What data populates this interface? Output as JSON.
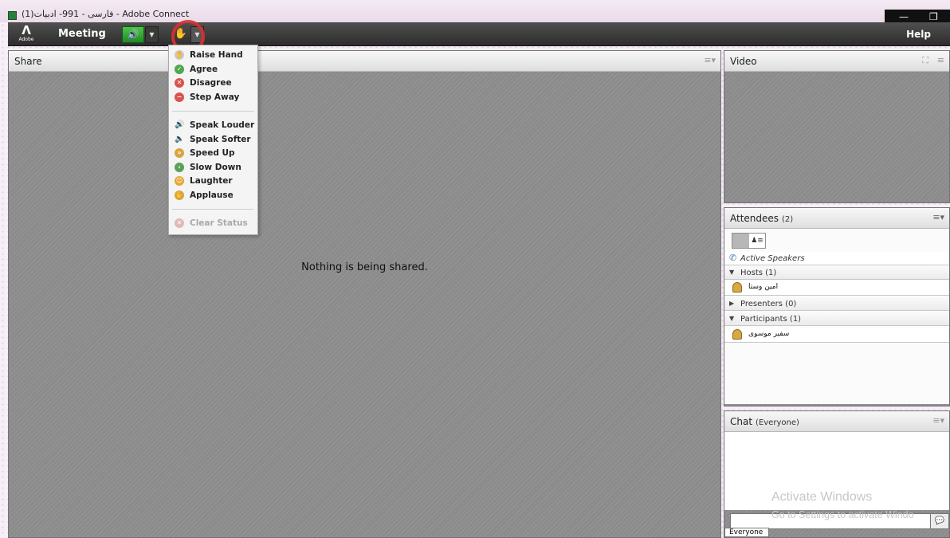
{
  "window": {
    "title": "(فارسی - 991- ادبیات(1 - Adobe Connect",
    "minimize_label": "—",
    "restore_label": "❐"
  },
  "toolbar": {
    "logo_word": "Adobe",
    "meeting_label": "Meeting",
    "help_label": "Help",
    "audio_icon": "speaker-icon",
    "status_icon": "raise-hand-icon"
  },
  "share_pod": {
    "title": "Share",
    "empty_message": "Nothing is being shared."
  },
  "status_menu": {
    "items": [
      {
        "label": "Raise Hand",
        "icon": "raise-hand-icon",
        "color": "#b8b8b8"
      },
      {
        "label": "Agree",
        "icon": "check-icon",
        "color": "#4fa84f"
      },
      {
        "label": "Disagree",
        "icon": "x-icon",
        "color": "#d9534f"
      },
      {
        "label": "Step Away",
        "icon": "minus-icon",
        "color": "#d9534f"
      },
      {
        "label": "Speak Louder",
        "icon": "speaker-louder-icon",
        "color": "#8d8d8d"
      },
      {
        "label": "Speak Softer",
        "icon": "speaker-softer-icon",
        "color": "#8d8d8d"
      },
      {
        "label": "Speed Up",
        "icon": "rabbit-icon",
        "color": "#d9a441"
      },
      {
        "label": "Slow Down",
        "icon": "turtle-icon",
        "color": "#5aa15a"
      },
      {
        "label": "Laughter",
        "icon": "smile-icon",
        "color": "#e6a630"
      },
      {
        "label": "Applause",
        "icon": "applause-icon",
        "color": "#d9a441"
      },
      {
        "label": "Clear Status",
        "icon": "clear-status-icon",
        "color": "#d8a0a0"
      }
    ]
  },
  "video_pod": {
    "title": "Video"
  },
  "attendees_pod": {
    "title": "Attendees",
    "count": "(2)",
    "active_speakers": "Active Speakers",
    "hosts_label": "Hosts (1)",
    "host_name": "امین وستا",
    "presenters_label": "Presenters (0)",
    "participants_label": "Participants (1)",
    "participant_name": "سفیر موسوی"
  },
  "chat_pod": {
    "title": "Chat",
    "scope": "(Everyone)",
    "tab_label": "Everyone"
  },
  "watermark": {
    "line1": "Activate Windows",
    "line2": "Go to Settings to activate Windo"
  }
}
